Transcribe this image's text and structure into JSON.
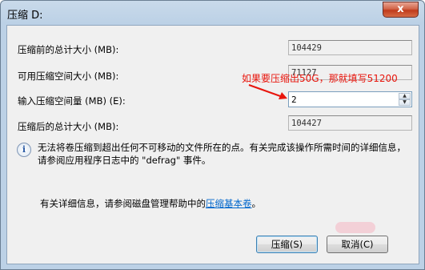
{
  "window": {
    "title": "压缩 D:",
    "close_glyph": "x"
  },
  "rows": [
    {
      "label": "压缩前的总计大小 (MB):",
      "value": "104429"
    },
    {
      "label": "可用压缩空间大小 (MB):",
      "value": "71127"
    },
    {
      "label": "输入压缩空间量 (MB) (E):",
      "value": "2"
    },
    {
      "label": "压缩后的总计大小 (MB):",
      "value": "104427"
    }
  ],
  "annotation": {
    "text": "如果要压缩出50G，那就填写51200",
    "color": "#e8150c"
  },
  "info": {
    "icon": "info-icon",
    "text": "无法将卷压缩到超出任何不可移动的文件所在的点。有关完成该操作所需时间的详细信息，请参阅应用程序日志中的 \"defrag\" 事件。"
  },
  "help": {
    "prefix": "有关详细信息，请参阅磁盘管理帮助中的",
    "link": "压缩基本卷",
    "suffix": "。"
  },
  "buttons": {
    "shrink": "压缩(S)",
    "cancel": "取消(C)"
  },
  "colors": {
    "accent": "#3c7fb1",
    "link": "#0066cc",
    "close": "#c03b1b"
  }
}
